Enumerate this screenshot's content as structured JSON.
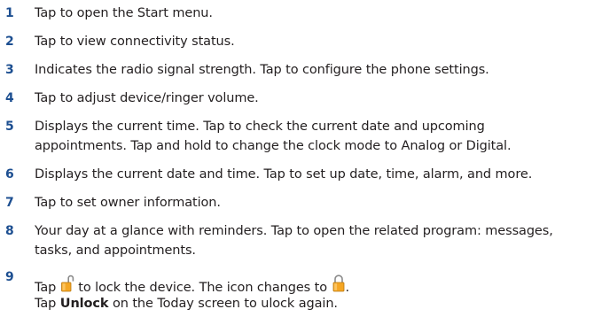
{
  "items": [
    {
      "number": "1",
      "text": "Tap to open the Start menu."
    },
    {
      "number": "2",
      "text": "Tap to view connectivity status."
    },
    {
      "number": "3",
      "text": "Indicates the radio signal strength. Tap to configure the phone settings."
    },
    {
      "number": "4",
      "text": "Tap to adjust device/ringer volume."
    },
    {
      "number": "5",
      "lines": [
        "Displays the current time. Tap to check the current date and upcoming",
        "appointments. Tap and hold to change the clock mode to Analog or Digital."
      ]
    },
    {
      "number": "6",
      "text": "Displays the current date and time. Tap to set up date, time, alarm, and more."
    },
    {
      "number": "7",
      "text": "Tap to set owner information."
    },
    {
      "number": "8",
      "lines": [
        "Your day at a glance with reminders. Tap to open the related program: messages,",
        "tasks, and appointments."
      ]
    },
    {
      "number": "9",
      "line1_before": "Tap ",
      "line1_middle": " to lock the device. The icon changes to ",
      "line1_after": ".",
      "line2_before": "Tap ",
      "line2_bold": "Unlock",
      "line2_after": " on the Today screen to ulock again.",
      "icons": [
        "unlocked-padlock-icon",
        "locked-padlock-icon"
      ],
      "icon_color": "#f5a623"
    }
  ],
  "colors": {
    "number": "#1d4f91",
    "text": "#231f20"
  }
}
